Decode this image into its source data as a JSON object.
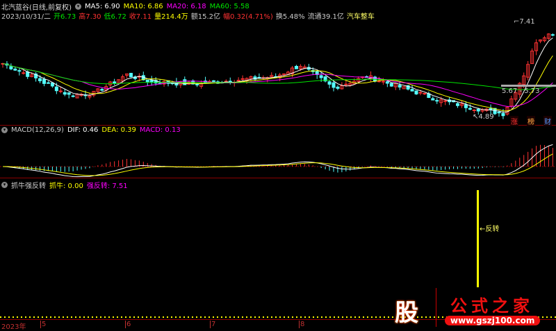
{
  "header": {
    "title": "北汽蓝谷(日线,前复权)",
    "ma5": "MA5: 6.90",
    "ma10": "MA10: 6.86",
    "ma20": "MA20: 6.18",
    "ma60": "MA60: 5.58"
  },
  "quote": {
    "date": "2023/10/31/二",
    "open": "开6.73",
    "high": "高7.30",
    "low": "低6.72",
    "close": "收7.11",
    "volume": "量214.4万",
    "amount": "额15.2亿",
    "change": "幅0.32(4.71%)",
    "turnover": "换5.48%",
    "float": "流通39.1亿",
    "sector": "汽车整车"
  },
  "annotations": {
    "high": "7.41",
    "low": "4.89",
    "range": "5.67 - 5.73"
  },
  "tags": [
    "涨",
    "榜",
    "财"
  ],
  "macd": {
    "label": "MACD(12,26,9)",
    "dif": "DIF: 0.46",
    "dea": "DEA: 0.39",
    "macd": "MACD: 0.13"
  },
  "indicator": {
    "label": "抓牛强反转",
    "zhuaniu": "抓牛: 0.00",
    "qiangfanzhuan": "强反转: 7.51",
    "signal": "←反转"
  },
  "xaxis": [
    "2023年",
    "5",
    "6",
    "7",
    "8"
  ],
  "logo": {
    "char": "股",
    "name": "公式之家",
    "url": "www.gszj100.com"
  },
  "colors": {
    "up": "#ff3232",
    "down": "#54ffff",
    "ma5": "#ffffff",
    "ma10": "#ffff00",
    "ma20": "#ff00ff",
    "ma60": "#00e600"
  },
  "price_keypoints": [
    [
      0,
      6.3
    ],
    [
      8,
      5.9
    ],
    [
      16,
      5.45
    ],
    [
      22,
      5.5
    ],
    [
      30,
      6.0
    ],
    [
      36,
      5.8
    ],
    [
      46,
      5.75
    ],
    [
      56,
      5.85
    ],
    [
      66,
      5.95
    ],
    [
      72,
      6.25
    ],
    [
      80,
      5.65
    ],
    [
      88,
      5.95
    ],
    [
      98,
      5.6
    ],
    [
      106,
      5.3
    ],
    [
      114,
      5.1
    ],
    [
      121,
      4.95
    ],
    [
      123,
      5.35
    ],
    [
      126,
      6.0
    ],
    [
      129,
      6.9
    ],
    [
      131,
      7.05
    ],
    [
      133,
      7.11
    ]
  ]
}
